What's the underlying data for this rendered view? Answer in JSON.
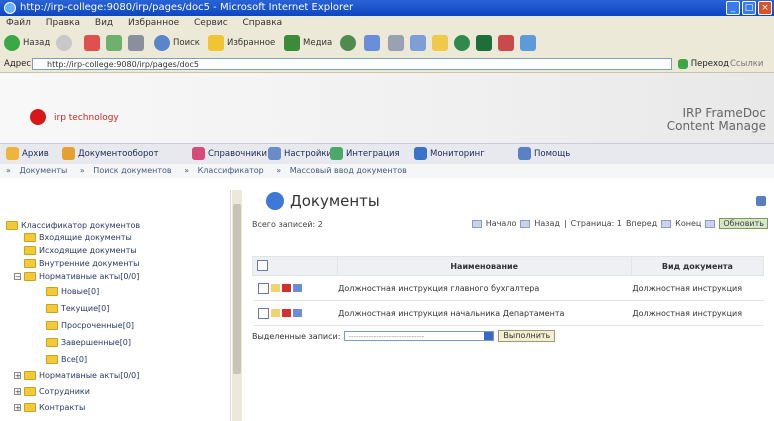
{
  "window": {
    "title": "http://irp-college:9080/irp/pages/doc5 - Microsoft Internet Explorer"
  },
  "menu": [
    "Файл",
    "Правка",
    "Вид",
    "Избранное",
    "Сервис",
    "Справка"
  ],
  "toolbar": {
    "back": "Назад",
    "search": "Поиск",
    "favorites": "Избранное",
    "media": "Медиа"
  },
  "address": {
    "label": "Адрес:",
    "url": "http://irp-college:9080/irp/pages/doc5",
    "go": "Переход",
    "links": "Ссылки"
  },
  "brand": {
    "logo_text": "irp technology",
    "title_line1": "IRP FrameDoc",
    "title_line2": "Content Manage"
  },
  "nav": [
    {
      "label": "Архив"
    },
    {
      "label": "Документооборот"
    },
    {
      "label": "Справочники"
    },
    {
      "label": "Настройки"
    },
    {
      "label": "Интеграция"
    },
    {
      "label": "Мониторинг"
    },
    {
      "label": "Помощь"
    }
  ],
  "breadcrumbs": [
    "Документы",
    "Поиск документов",
    "Классификатор",
    "Массовый ввод документов"
  ],
  "tree": [
    {
      "label": "Классификатор документов",
      "level": 0
    },
    {
      "label": "Входящие документы",
      "level": 1
    },
    {
      "label": "Исходящие документы",
      "level": 1
    },
    {
      "label": "Внутренние документы",
      "level": 1
    },
    {
      "label": "Нормативные акты[0/0]",
      "level": 0
    },
    {
      "label": "Новые[0]",
      "level": 2
    },
    {
      "label": "Текущие[0]",
      "level": 2
    },
    {
      "label": "Просроченные[0]",
      "level": 2
    },
    {
      "label": "Завершенные[0]",
      "level": 2
    },
    {
      "label": "Все[0]",
      "level": 2
    },
    {
      "label": "Нормативные акты[0/0]",
      "level": 0
    },
    {
      "label": "Сотрудники",
      "level": 0
    },
    {
      "label": "Контракты",
      "level": 0
    }
  ],
  "main": {
    "title": "Документы",
    "total": "Всего записей: 2",
    "pager": {
      "start": "Начало",
      "prev": "Назад",
      "page": "Страница: 1",
      "next": "Вперед",
      "end": "Конец",
      "refresh": "Обновить"
    },
    "table": {
      "headers": [
        "",
        "Наименование",
        "Вид документа"
      ],
      "rows": [
        {
          "name": "Должностная инструкция главного бухгалтера",
          "type": "Должностная инструкция"
        },
        {
          "name": "Должностная инструкция начальника Департамента",
          "type": "Должностная инструкция"
        }
      ]
    },
    "selected": {
      "label": "Выделенные записи:",
      "placeholder": "------------------------------",
      "run": "Выполнить"
    }
  },
  "colors": {
    "titlebar": "#0d46c1",
    "menu": "#ece9d8",
    "nav_bg": "#e7e9ee",
    "accent": "#3f79d8"
  }
}
